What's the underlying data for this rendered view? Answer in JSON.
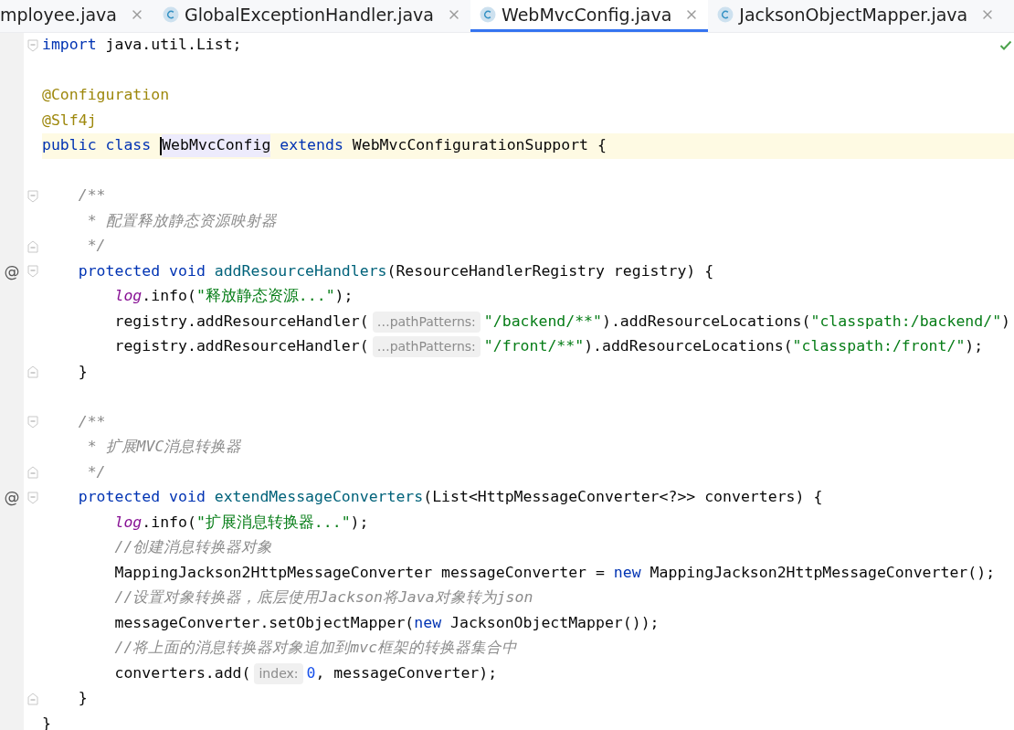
{
  "tabs": [
    {
      "label": "mployee.java",
      "selected": false,
      "icon": false
    },
    {
      "label": "GlobalExceptionHandler.java",
      "selected": false,
      "icon": true
    },
    {
      "label": "WebMvcConfig.java",
      "selected": true,
      "icon": true
    },
    {
      "label": "JacksonObjectMapper.java",
      "selected": false,
      "icon": true
    }
  ],
  "editor": {
    "lines": [
      {
        "kind": "code",
        "fold_start": true,
        "tokens": [
          {
            "kind": "keyword",
            "text": "import"
          },
          {
            "kind": "plain",
            "text": " java.util.List;"
          }
        ]
      },
      {
        "kind": "blank"
      },
      {
        "kind": "code",
        "tokens": [
          {
            "kind": "annotation",
            "text": "@Configuration"
          }
        ]
      },
      {
        "kind": "code",
        "tokens": [
          {
            "kind": "annotation",
            "text": "@Slf4j"
          }
        ]
      },
      {
        "kind": "code",
        "current": true,
        "tokens": [
          {
            "kind": "keyword",
            "text": "public class "
          },
          {
            "kind": "usage",
            "text": "WebMvcConfig",
            "caret": true
          },
          {
            "kind": "keyword",
            "text": " extends"
          },
          {
            "kind": "plain",
            "text": " WebMvcConfigurationSupport {"
          }
        ]
      },
      {
        "kind": "blank"
      },
      {
        "kind": "code",
        "fold_start": true,
        "tokens": [
          {
            "kind": "comment",
            "text": "    /**"
          }
        ]
      },
      {
        "kind": "code",
        "tokens": [
          {
            "kind": "comment",
            "text": "     * 配置释放静态资源映射器"
          }
        ]
      },
      {
        "kind": "code",
        "fold_end": true,
        "tokens": [
          {
            "kind": "comment",
            "text": "     */"
          }
        ]
      },
      {
        "kind": "code",
        "fold_start": true,
        "gutter_mark": "@",
        "tokens": [
          {
            "kind": "keyword",
            "text": "    protected void "
          },
          {
            "kind": "method",
            "text": "addResourceHandlers"
          },
          {
            "kind": "plain",
            "text": "(ResourceHandlerRegistry registry) {"
          }
        ]
      },
      {
        "kind": "code",
        "tokens": [
          {
            "kind": "static",
            "text": "        log"
          },
          {
            "kind": "plain",
            "text": ".info("
          },
          {
            "kind": "string",
            "text": "\"释放静态资源...\""
          },
          {
            "kind": "plain",
            "text": ");"
          }
        ]
      },
      {
        "kind": "code",
        "tokens": [
          {
            "kind": "plain",
            "text": "        registry.addResourceHandler("
          },
          {
            "kind": "hint",
            "text": "…pathPatterns:"
          },
          {
            "kind": "string",
            "text": "\"/backend/**\""
          },
          {
            "kind": "plain",
            "text": ").addResourceLocations("
          },
          {
            "kind": "string",
            "text": "\"classpath:/backend/\""
          },
          {
            "kind": "plain",
            "text": ")"
          }
        ]
      },
      {
        "kind": "code",
        "tokens": [
          {
            "kind": "plain",
            "text": "        registry.addResourceHandler("
          },
          {
            "kind": "hint",
            "text": "…pathPatterns:"
          },
          {
            "kind": "string",
            "text": "\"/front/**\""
          },
          {
            "kind": "plain",
            "text": ").addResourceLocations("
          },
          {
            "kind": "string",
            "text": "\"classpath:/front/\""
          },
          {
            "kind": "plain",
            "text": ");"
          }
        ]
      },
      {
        "kind": "code",
        "fold_end": true,
        "tokens": [
          {
            "kind": "plain",
            "text": "    }"
          }
        ]
      },
      {
        "kind": "blank"
      },
      {
        "kind": "code",
        "fold_start": true,
        "tokens": [
          {
            "kind": "comment",
            "text": "    /**"
          }
        ]
      },
      {
        "kind": "code",
        "tokens": [
          {
            "kind": "comment",
            "text": "     * 扩展MVC消息转换器"
          }
        ]
      },
      {
        "kind": "code",
        "fold_end": true,
        "tokens": [
          {
            "kind": "comment",
            "text": "     */"
          }
        ]
      },
      {
        "kind": "code",
        "fold_start": true,
        "gutter_mark": "@",
        "tokens": [
          {
            "kind": "keyword",
            "text": "    protected void "
          },
          {
            "kind": "method",
            "text": "extendMessageConverters"
          },
          {
            "kind": "plain",
            "text": "(List<HttpMessageConverter<?>> converters) {"
          }
        ]
      },
      {
        "kind": "code",
        "tokens": [
          {
            "kind": "static",
            "text": "        log"
          },
          {
            "kind": "plain",
            "text": ".info("
          },
          {
            "kind": "string",
            "text": "\"扩展消息转换器...\""
          },
          {
            "kind": "plain",
            "text": ");"
          }
        ]
      },
      {
        "kind": "code",
        "tokens": [
          {
            "kind": "comment",
            "text": "        //创建消息转换器对象"
          }
        ]
      },
      {
        "kind": "code",
        "tokens": [
          {
            "kind": "plain",
            "text": "        MappingJackson2HttpMessageConverter messageConverter = "
          },
          {
            "kind": "keyword",
            "text": "new"
          },
          {
            "kind": "plain",
            "text": " MappingJackson2HttpMessageConverter();"
          }
        ]
      },
      {
        "kind": "code",
        "tokens": [
          {
            "kind": "comment",
            "text": "        //设置对象转换器，底层使用Jackson将Java对象转为json"
          }
        ]
      },
      {
        "kind": "code",
        "tokens": [
          {
            "kind": "plain",
            "text": "        messageConverter.setObjectMapper("
          },
          {
            "kind": "keyword",
            "text": "new"
          },
          {
            "kind": "plain",
            "text": " JacksonObjectMapper());"
          }
        ]
      },
      {
        "kind": "code",
        "tokens": [
          {
            "kind": "comment",
            "text": "        //将上面的消息转换器对象追加到mvc框架的转换器集合中"
          }
        ]
      },
      {
        "kind": "code",
        "tokens": [
          {
            "kind": "plain",
            "text": "        converters.add("
          },
          {
            "kind": "hint",
            "text": "index:"
          },
          {
            "kind": "number",
            "text": "0"
          },
          {
            "kind": "plain",
            "text": ", messageConverter);"
          }
        ]
      },
      {
        "kind": "code",
        "fold_end": true,
        "tokens": [
          {
            "kind": "plain",
            "text": "    }"
          }
        ]
      },
      {
        "kind": "code",
        "tokens": [
          {
            "kind": "plain",
            "text": "}"
          }
        ]
      }
    ]
  }
}
